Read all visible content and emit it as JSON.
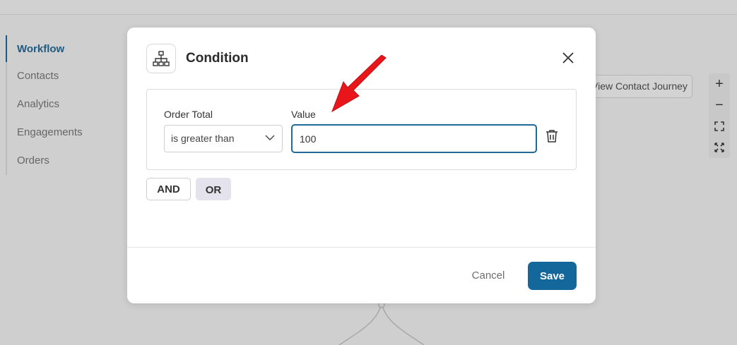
{
  "sidebar": {
    "items": [
      {
        "label": "Workflow",
        "active": true
      },
      {
        "label": "Contacts"
      },
      {
        "label": "Analytics"
      },
      {
        "label": "Engagements"
      },
      {
        "label": "Orders"
      }
    ]
  },
  "toolbar": {
    "journey_label": "View Contact Journey",
    "zoom_in": "+",
    "zoom_out": "−"
  },
  "modal": {
    "title": "Condition",
    "icon": "flowchart-icon",
    "condition": {
      "field_label": "Order Total",
      "value_label": "Value",
      "operator": "is greater than",
      "value": "100"
    },
    "and_label": "AND",
    "or_label": "OR",
    "cancel_label": "Cancel",
    "save_label": "Save"
  },
  "colors": {
    "accent": "#14679a",
    "annotation": "#e8161b",
    "overlay": "#cfcfcf"
  }
}
